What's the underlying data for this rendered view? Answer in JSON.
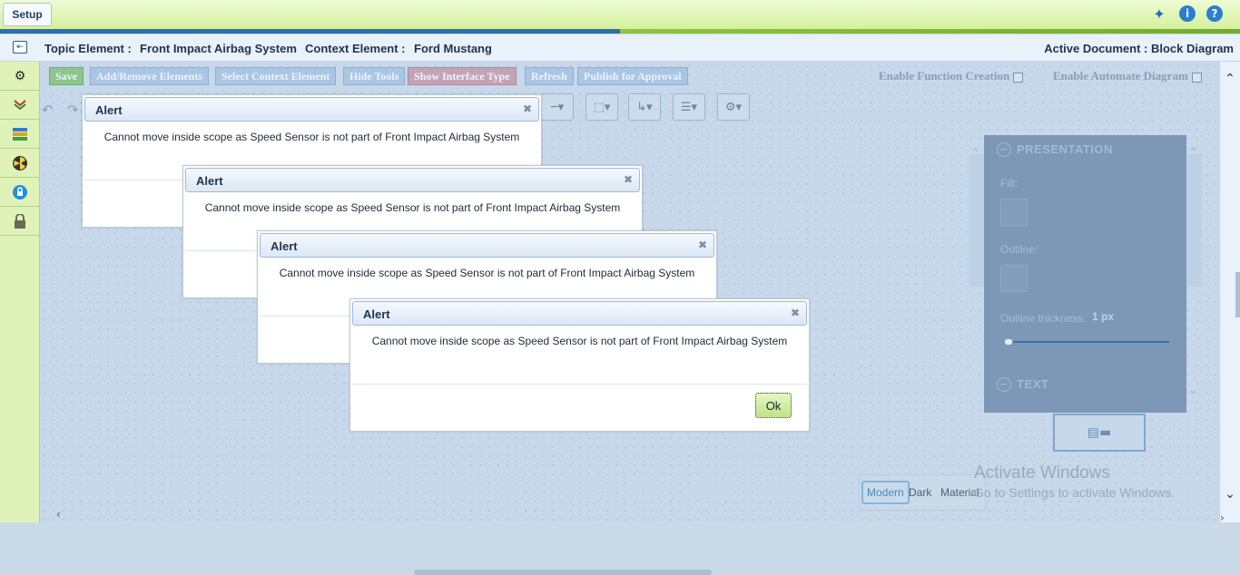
{
  "topbar": {
    "tab_label": "Setup",
    "icons": [
      "pin-icon",
      "info-icon",
      "help-icon"
    ]
  },
  "header": {
    "topic_label": "Topic Element :",
    "topic_value": "Front Impact Airbag System",
    "context_label": "Context Element :",
    "context_value": "Ford Mustang",
    "active_document": "Active Document : Block Diagram"
  },
  "sidebar": {
    "items": [
      "gear-icon",
      "layers-icon",
      "ruler-icon",
      "radiation-icon",
      "lock-circle-icon",
      "padlock-icon"
    ]
  },
  "toolbar": {
    "save": "Save",
    "add_remove": "Add/Remove Elements",
    "select_context": "Select Context Element",
    "hide_tools": "Hide Tools",
    "show_interface": "Show Interface Type",
    "refresh": "Refresh",
    "publish": "Publish for Approval",
    "enable_function": "Enable Function Creation",
    "enable_automate": "Enable Automate Diagram"
  },
  "panel": {
    "presentation": "PRESENTATION",
    "fill_label": "Fill:",
    "outline_label": "Outline:",
    "thickness_label": "Outline thickness:",
    "thickness_value": "1 px",
    "text_section": "TEXT"
  },
  "themes": {
    "modern": "Modern",
    "dark": "Dark",
    "material": "Material"
  },
  "watermark": {
    "line1": "Activate Windows",
    "line2": "Go to Settings to activate Windows."
  },
  "dialogs": [
    {
      "title": "Alert",
      "message": "Cannot move inside scope as Speed Sensor is not part of Front Impact Airbag System"
    },
    {
      "title": "Alert",
      "message": "Cannot move inside scope as Speed Sensor is not part of Front Impact Airbag System"
    },
    {
      "title": "Alert",
      "message": "Cannot move inside scope as Speed Sensor is not part of Front Impact Airbag System"
    },
    {
      "title": "Alert",
      "message": "Cannot move inside scope as Speed Sensor is not part of Front Impact Airbag System",
      "ok_label": "Ok"
    }
  ]
}
